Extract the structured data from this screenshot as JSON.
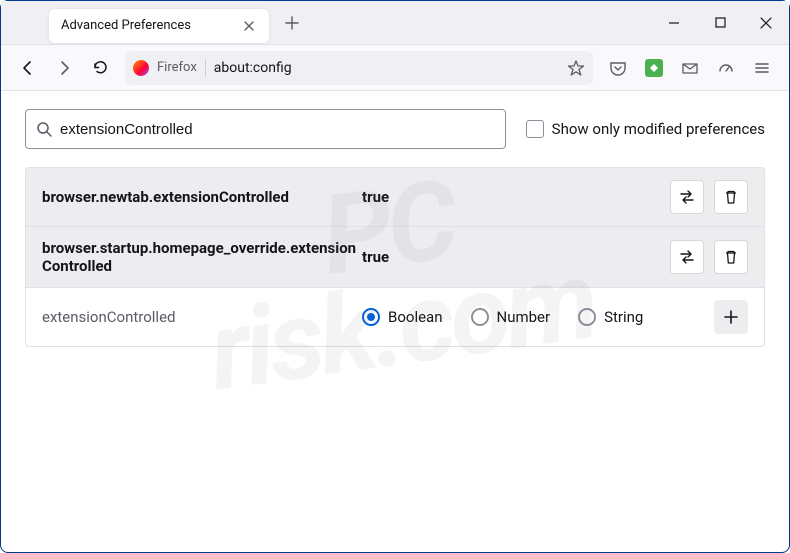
{
  "tab": {
    "title": "Advanced Preferences"
  },
  "urlbar": {
    "brand": "Firefox",
    "address": "about:config"
  },
  "search": {
    "value": "extensionControlled",
    "checkbox_label": "Show only modified preferences"
  },
  "prefs": [
    {
      "name": "browser.newtab.extensionControlled",
      "value": "true"
    },
    {
      "name": "browser.startup.homepage_override.extensionControlled",
      "value": "true"
    }
  ],
  "newpref": {
    "name": "extensionControlled",
    "type_options": [
      "Boolean",
      "Number",
      "String"
    ],
    "selected_type": "Boolean"
  },
  "watermark": "PC\nrisk.com"
}
